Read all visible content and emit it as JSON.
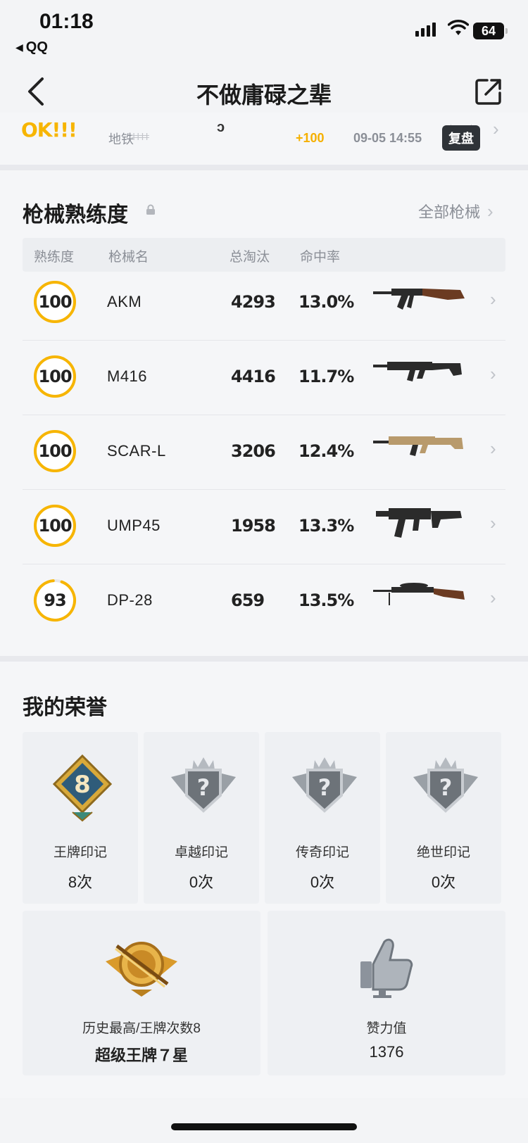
{
  "status_bar": {
    "time": "01:18",
    "back_app": "QQ",
    "battery": "64"
  },
  "nav": {
    "title": "不做庸碌之辈"
  },
  "match": {
    "rank_text": "OK!!!",
    "map": "地铁",
    "people": "ǂǂǂǂ",
    "misc": "ɔ",
    "score": "+100",
    "time": "09-05 14:55",
    "review_label": "复盘"
  },
  "weapons": {
    "title": "枪械熟练度",
    "all_label": "全部枪械",
    "headers": {
      "mastery": "熟练度",
      "name": "枪械名",
      "kills": "总淘汰",
      "accuracy": "命中率"
    },
    "rows": [
      {
        "mastery": "100",
        "mastery_pct": 1.0,
        "name": "AKM",
        "kills": "4293",
        "accuracy": "13.0%",
        "gun_icon": "akm-rifle-icon"
      },
      {
        "mastery": "100",
        "mastery_pct": 1.0,
        "name": "M416",
        "kills": "4416",
        "accuracy": "11.7%",
        "gun_icon": "m416-rifle-icon"
      },
      {
        "mastery": "100",
        "mastery_pct": 1.0,
        "name": "SCAR-L",
        "kills": "3206",
        "accuracy": "12.4%",
        "gun_icon": "scarl-rifle-icon"
      },
      {
        "mastery": "100",
        "mastery_pct": 1.0,
        "name": "UMP45",
        "kills": "1958",
        "accuracy": "13.3%",
        "gun_icon": "ump45-smg-icon"
      },
      {
        "mastery": "93",
        "mastery_pct": 0.93,
        "name": "DP-28",
        "kills": "659",
        "accuracy": "13.5%",
        "gun_icon": "dp28-lmg-icon"
      }
    ]
  },
  "honor": {
    "title": "我的荣誉",
    "marks": [
      {
        "label": "王牌印记",
        "count": "8次",
        "emblem_text": "8"
      },
      {
        "label": "卓越印记",
        "count": "0次",
        "emblem_text": "?"
      },
      {
        "label": "传奇印记",
        "count": "0次",
        "emblem_text": "?"
      },
      {
        "label": "绝世印记",
        "count": "0次",
        "emblem_text": "?"
      }
    ],
    "peak": {
      "label": "历史最高/王牌次数8",
      "value": "超级王牌７星"
    },
    "likes": {
      "label": "赞力值",
      "value": "1376"
    }
  },
  "colors": {
    "accent": "#f7b500",
    "ring_track": "#e6e7ea",
    "muted": "#8b8f97"
  }
}
